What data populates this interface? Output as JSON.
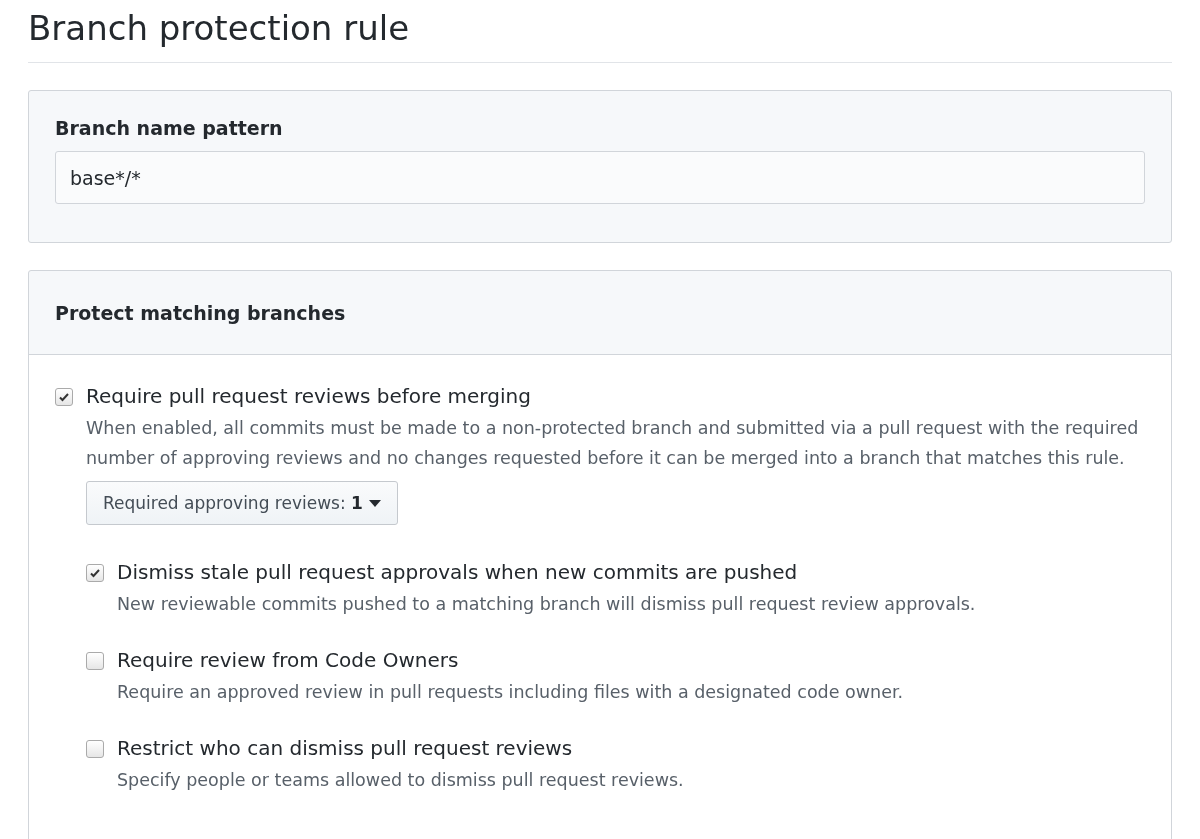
{
  "title": "Branch protection rule",
  "pattern": {
    "label": "Branch name pattern",
    "value": "base*/*"
  },
  "protect": {
    "heading": "Protect matching branches",
    "rules": [
      {
        "label": "Require pull request reviews before merging",
        "description": "When enabled, all commits must be made to a non-protected branch and submitted via a pull request with the required number of approving reviews and no changes requested before it can be merged into a branch that matches this rule.",
        "checked": true,
        "dropdown": {
          "label": "Required approving reviews:",
          "value": "1"
        },
        "children": [
          {
            "label": "Dismiss stale pull request approvals when new commits are pushed",
            "description": "New reviewable commits pushed to a matching branch will dismiss pull request review approvals.",
            "checked": true
          },
          {
            "label": "Require review from Code Owners",
            "description": "Require an approved review in pull requests including files with a designated code owner.",
            "checked": false
          },
          {
            "label": "Restrict who can dismiss pull request reviews",
            "description": "Specify people or teams allowed to dismiss pull request reviews.",
            "checked": false
          }
        ]
      }
    ]
  }
}
